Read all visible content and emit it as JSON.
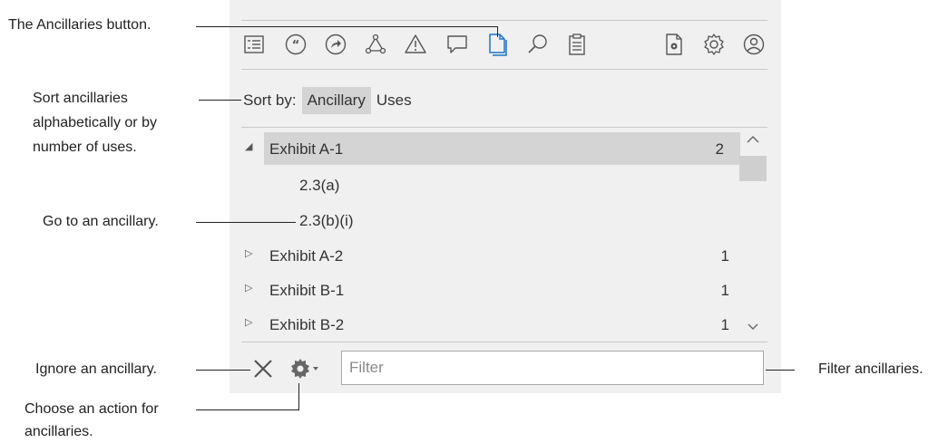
{
  "toolbar": {
    "icons": [
      "outline-icon",
      "quotes-icon",
      "cross-reference-icon",
      "network-icon",
      "warning-icon",
      "comment-icon",
      "ancillaries-icon",
      "search-icon",
      "clipboard-icon",
      "document-settings-icon",
      "gear-icon",
      "account-icon"
    ],
    "active_icon": "ancillaries-icon",
    "accent_color": "#1e73c8"
  },
  "sort": {
    "label": "Sort by:",
    "options": [
      "Ancillary",
      "Uses"
    ],
    "selected": "Ancillary"
  },
  "list": {
    "items": [
      {
        "label": "Exhibit A-1",
        "count": "2",
        "expanded": true,
        "selected": true,
        "children": [
          "2.3(a)",
          "2.3(b)(i)"
        ]
      },
      {
        "label": "Exhibit A-2",
        "count": "1",
        "expanded": false
      },
      {
        "label": "Exhibit B-1",
        "count": "1",
        "expanded": false
      },
      {
        "label": "Exhibit B-2",
        "count": "1",
        "expanded": false
      }
    ]
  },
  "footer": {
    "ignore_icon": "close-icon",
    "action_icon": "gear-dropdown-icon",
    "filter_placeholder": "Filter"
  },
  "callouts": {
    "ancillaries_button": "The Ancillaries button.",
    "sort_line1": "Sort ancillaries",
    "sort_line2": "alphabetically or by",
    "sort_line3": "number of uses.",
    "go_to": "Go to an ancillary.",
    "ignore": "Ignore an ancillary.",
    "action_line1": "Choose an action for",
    "action_line2": "ancillaries.",
    "filter": "Filter ancillaries."
  }
}
